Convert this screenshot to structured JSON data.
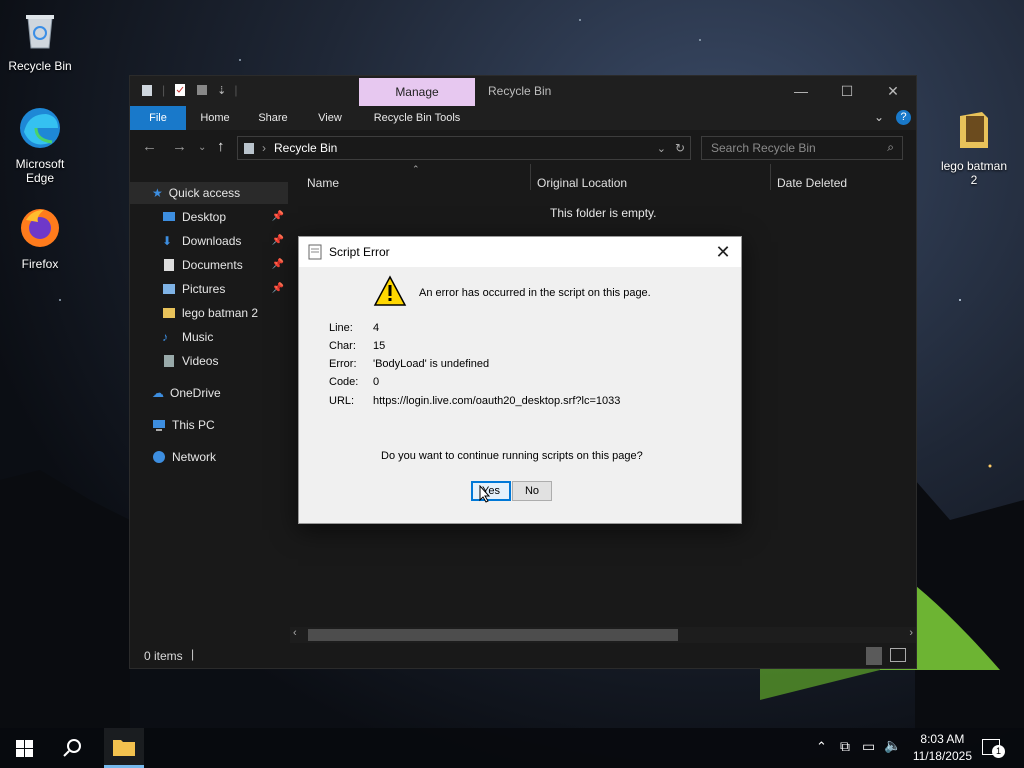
{
  "desktop": {
    "icons": [
      {
        "label": "Recycle Bin"
      },
      {
        "label_line1": "Microsoft",
        "label_line2": "Edge"
      },
      {
        "label": "Firefox"
      },
      {
        "label_line1": "lego batman",
        "label_line2": "2"
      }
    ]
  },
  "window": {
    "manage_tab": "Manage",
    "title": "Recycle Bin",
    "ribbon_tabs": [
      "File",
      "Home",
      "Share",
      "View",
      "Recycle Bin Tools"
    ],
    "address": "Recycle Bin",
    "search_placeholder": "Search Recycle Bin",
    "nav": {
      "quick_access": "Quick access",
      "items": [
        "Desktop",
        "Downloads",
        "Documents",
        "Pictures",
        "lego batman 2",
        "Music",
        "Videos"
      ],
      "onedrive": "OneDrive",
      "this_pc": "This PC",
      "network": "Network"
    },
    "columns": [
      "Name",
      "Original Location",
      "Date Deleted"
    ],
    "empty_message": "This folder is empty.",
    "status": "0 items"
  },
  "dialog": {
    "title": "Script Error",
    "message": "An error has occurred in the script on this page.",
    "fields": [
      {
        "label": "Line:",
        "value": "4"
      },
      {
        "label": "Char:",
        "value": "15"
      },
      {
        "label": "Error:",
        "value": "'BodyLoad' is undefined"
      },
      {
        "label": "Code:",
        "value": "0"
      },
      {
        "label": "URL:",
        "value": "https://login.live.com/oauth20_desktop.srf?lc=1033"
      }
    ],
    "question": "Do you want to continue running scripts on this page?",
    "yes_label": "Yes",
    "no_label": "No"
  },
  "taskbar": {
    "time": "8:03 AM",
    "date": "11/18/2025",
    "notification_count": "1"
  },
  "colors": {
    "accent": "#1979ca",
    "manage_tab": "#e7c8f0",
    "dialog_bg": "#f0f0f0",
    "default_button_border": "#0078d7"
  }
}
